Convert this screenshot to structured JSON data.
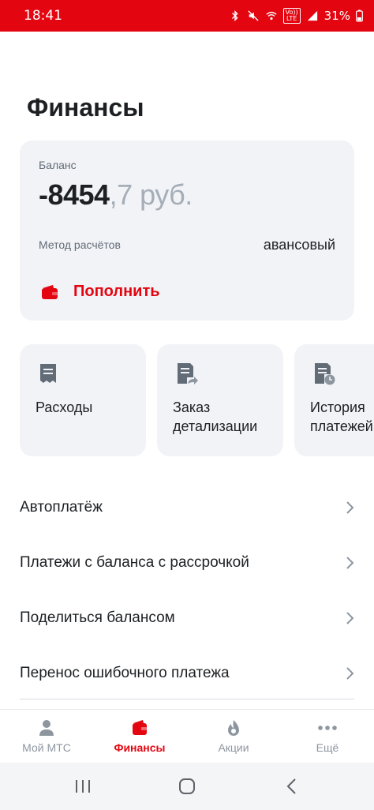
{
  "status_bar": {
    "time": "18:41",
    "volte_text": "Vo))\nLTE",
    "battery_text": "31%",
    "icons": [
      "bluetooth-icon",
      "mute-icon",
      "wifi-icon",
      "volte-icon",
      "signal-icon",
      "battery-icon"
    ]
  },
  "page": {
    "title": "Финансы"
  },
  "balance": {
    "label": "Баланс",
    "amount_main": "-8454",
    "amount_fraction": ",7 руб.",
    "method_label": "Метод расчётов",
    "method_value": "авансовый",
    "topup_label": "Пополнить"
  },
  "tiles": [
    {
      "label": "Расходы",
      "icon": "receipt-icon"
    },
    {
      "label": "Заказ\nдетализации",
      "icon": "document-share-icon"
    },
    {
      "label": "История\nплатежей",
      "icon": "document-clock-icon"
    }
  ],
  "list": [
    {
      "label": "Автоплатёж"
    },
    {
      "label": "Платежи с баланса с рассрочкой"
    },
    {
      "label": "Поделиться балансом"
    },
    {
      "label": "Перенос ошибочного платежа"
    }
  ],
  "tabbar": {
    "tabs": [
      {
        "label": "Мой МТС",
        "icon": "person-icon",
        "active": false
      },
      {
        "label": "Финансы",
        "icon": "wallet-icon",
        "active": true
      },
      {
        "label": "Акции",
        "icon": "flame-icon",
        "active": false
      },
      {
        "label": "Ещё",
        "icon": "more-dots-icon",
        "active": false
      }
    ]
  },
  "colors": {
    "brand": "#e30611",
    "card_bg": "#f2f3f7",
    "text_primary": "#1d2023",
    "text_secondary": "#626c77",
    "inactive": "#8d969f"
  },
  "system_nav": {
    "buttons": [
      "recent-apps-icon",
      "home-icon",
      "back-icon"
    ]
  }
}
